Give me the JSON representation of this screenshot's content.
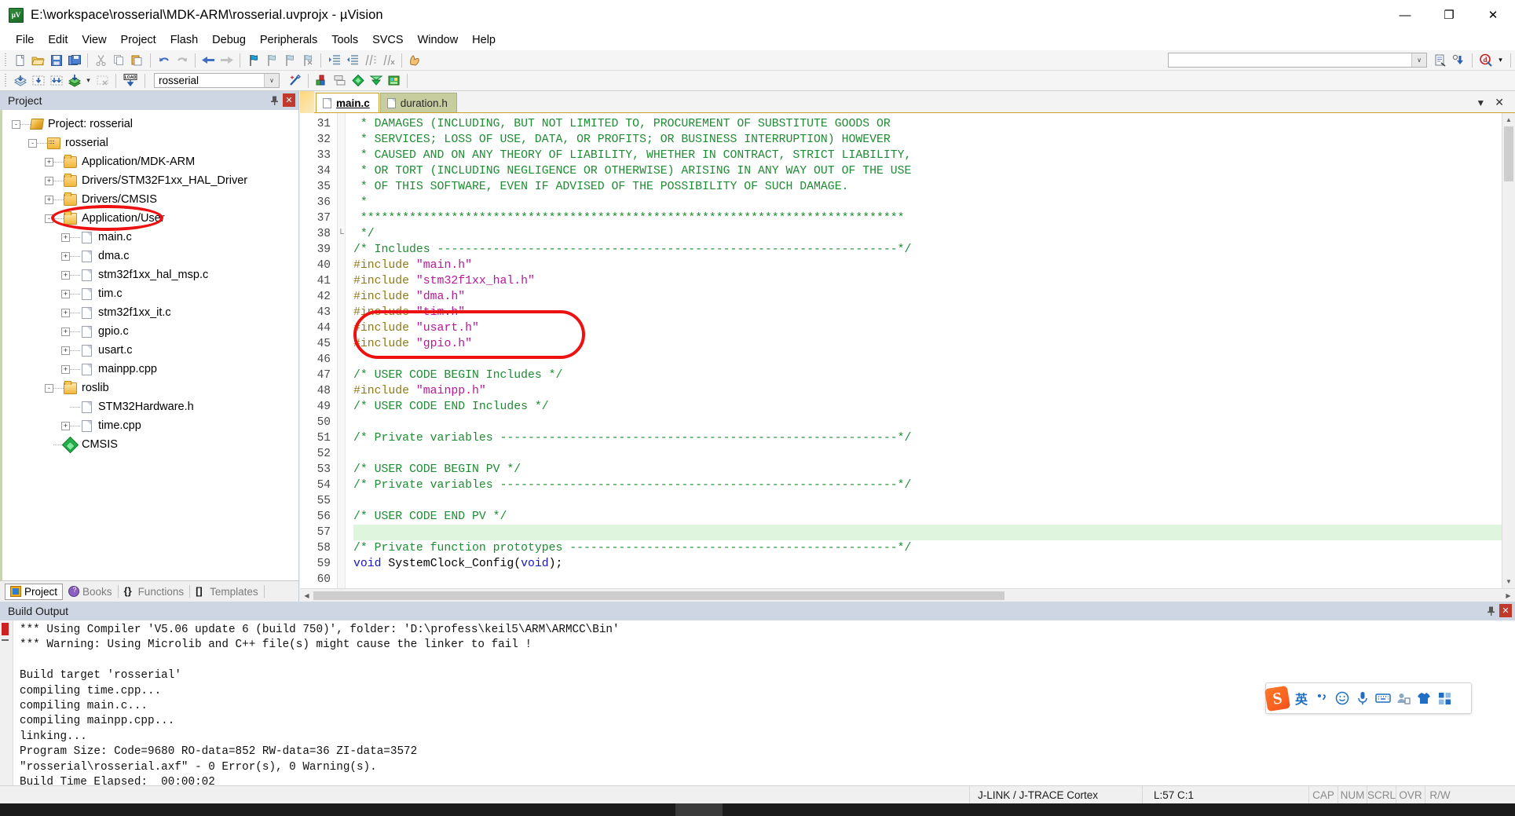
{
  "window": {
    "title": "E:\\workspace\\rosserial\\MDK-ARM\\rosserial.uvprojx - µVision",
    "app_icon": "uvision-icon",
    "minimize": "—",
    "maximize": "❐",
    "close": "✕"
  },
  "menu": {
    "items": [
      {
        "label": "File"
      },
      {
        "label": "Edit"
      },
      {
        "label": "View"
      },
      {
        "label": "Project"
      },
      {
        "label": "Flash"
      },
      {
        "label": "Debug"
      },
      {
        "label": "Peripherals"
      },
      {
        "label": "Tools"
      },
      {
        "label": "SVCS"
      },
      {
        "label": "Window"
      },
      {
        "label": "Help"
      }
    ]
  },
  "toolbar_file": {
    "buttons": [
      "new-file-icon",
      "open-file-icon",
      "save-icon",
      "save-all-icon",
      "cut-icon",
      "copy-icon",
      "paste-icon",
      "undo-icon",
      "redo-icon",
      "navigate-back-icon",
      "navigate-forward-icon",
      "bookmark-toggle-icon",
      "bookmark-prev-icon",
      "bookmark-next-icon",
      "bookmark-clear-icon",
      "indent-icon",
      "outdent-icon",
      "comment-icon",
      "uncomment-icon",
      "insert-occurrence-icon"
    ],
    "find_value": "",
    "find_placeholder": "",
    "find_in_files_icon": "find-in-files-icon",
    "incremental_find_icon": "incremental-find-icon",
    "debug_icon": "start-debug-session-icon",
    "debug_dropdown": "▾"
  },
  "toolbar_build": {
    "buttons": [
      "translate-icon",
      "build-icon",
      "rebuild-icon",
      "batch-build-icon",
      "batch-build-dropdown",
      "stop-build-icon",
      "download-icon"
    ],
    "target_label": "rosserial",
    "target_dropdown": "∨",
    "buttons_right": [
      "target-options-wizard-icon",
      "target-options-icon",
      "manage-project-items-icon",
      "pack-installer-icon",
      "configure-rte-icon",
      "manage-run-time-env-icon"
    ]
  },
  "project_panel": {
    "title": "Project",
    "pin_icon": "pin-icon",
    "close_icon": "close-icon",
    "tree": [
      {
        "label": "Project: rosserial",
        "indent": 0,
        "expander": "-",
        "icon": "project-icon"
      },
      {
        "label": "rosserial",
        "indent": 1,
        "expander": "-",
        "icon": "target-icon"
      },
      {
        "label": "Application/MDK-ARM",
        "indent": 2,
        "expander": "+",
        "icon": "folder-closed-icon"
      },
      {
        "label": "Drivers/STM32F1xx_HAL_Driver",
        "indent": 2,
        "expander": "+",
        "icon": "folder-closed-icon"
      },
      {
        "label": "Drivers/CMSIS",
        "indent": 2,
        "expander": "+",
        "icon": "folder-closed-icon"
      },
      {
        "label": "Application/User",
        "indent": 2,
        "expander": "-",
        "icon": "folder-open-icon"
      },
      {
        "label": "main.c",
        "indent": 3,
        "expander": "+",
        "icon": "file-icon"
      },
      {
        "label": "dma.c",
        "indent": 3,
        "expander": "+",
        "icon": "file-icon"
      },
      {
        "label": "stm32f1xx_hal_msp.c",
        "indent": 3,
        "expander": "+",
        "icon": "file-icon"
      },
      {
        "label": "tim.c",
        "indent": 3,
        "expander": "+",
        "icon": "file-icon"
      },
      {
        "label": "stm32f1xx_it.c",
        "indent": 3,
        "expander": "+",
        "icon": "file-icon"
      },
      {
        "label": "gpio.c",
        "indent": 3,
        "expander": "+",
        "icon": "file-icon"
      },
      {
        "label": "usart.c",
        "indent": 3,
        "expander": "+",
        "icon": "file-icon"
      },
      {
        "label": "mainpp.cpp",
        "indent": 3,
        "expander": "+",
        "icon": "file-icon"
      },
      {
        "label": "roslib",
        "indent": 2,
        "expander": "-",
        "icon": "folder-open-icon"
      },
      {
        "label": "STM32Hardware.h",
        "indent": 3,
        "expander": "",
        "icon": "file-icon"
      },
      {
        "label": "time.cpp",
        "indent": 3,
        "expander": "+",
        "icon": "file-icon"
      },
      {
        "label": "CMSIS",
        "indent": 2,
        "expander": "",
        "icon": "cmsis-icon"
      }
    ],
    "tabs": [
      {
        "label": "Project",
        "icon": "project-tab-icon",
        "active": true
      },
      {
        "label": "Books",
        "icon": "books-tab-icon",
        "active": false
      },
      {
        "label": "Functions",
        "icon": "functions-tab-icon",
        "active": false
      },
      {
        "label": "Templates",
        "icon": "templates-tab-icon",
        "active": false
      }
    ]
  },
  "editor": {
    "tabs": [
      {
        "label": "main.c",
        "active": true
      },
      {
        "label": "duration.h",
        "active": false
      }
    ],
    "tab_dropdown_icon": "tab-list-dropdown-icon",
    "tab_close_icon": "close-document-icon",
    "first_line_number": 31,
    "highlight_line": 57,
    "lines": [
      {
        "n": 31,
        "tokens": [
          {
            "t": "cmt",
            "v": " * DAMAGES (INCLUDING, BUT NOT LIMITED TO, PROCUREMENT OF SUBSTITUTE GOODS OR"
          }
        ]
      },
      {
        "n": 32,
        "tokens": [
          {
            "t": "cmt",
            "v": " * SERVICES; LOSS OF USE, DATA, OR PROFITS; OR BUSINESS INTERRUPTION) HOWEVER"
          }
        ]
      },
      {
        "n": 33,
        "tokens": [
          {
            "t": "cmt",
            "v": " * CAUSED AND ON ANY THEORY OF LIABILITY, WHETHER IN CONTRACT, STRICT LIABILITY,"
          }
        ]
      },
      {
        "n": 34,
        "tokens": [
          {
            "t": "cmt",
            "v": " * OR TORT (INCLUDING NEGLIGENCE OR OTHERWISE) ARISING IN ANY WAY OUT OF THE USE"
          }
        ]
      },
      {
        "n": 35,
        "tokens": [
          {
            "t": "cmt",
            "v": " * OF THIS SOFTWARE, EVEN IF ADVISED OF THE POSSIBILITY OF SUCH DAMAGE."
          }
        ]
      },
      {
        "n": 36,
        "tokens": [
          {
            "t": "cmt",
            "v": " *"
          }
        ]
      },
      {
        "n": 37,
        "tokens": [
          {
            "t": "cmt",
            "v": " ******************************************************************************"
          }
        ]
      },
      {
        "n": 38,
        "tokens": [
          {
            "t": "cmt",
            "v": " */"
          }
        ]
      },
      {
        "n": 39,
        "tokens": [
          {
            "t": "cmt",
            "v": "/* Includes ------------------------------------------------------------------*/"
          }
        ]
      },
      {
        "n": 40,
        "tokens": [
          {
            "t": "pre",
            "v": "#include "
          },
          {
            "t": "str",
            "v": "\"main.h\""
          }
        ]
      },
      {
        "n": 41,
        "tokens": [
          {
            "t": "pre",
            "v": "#include "
          },
          {
            "t": "str",
            "v": "\"stm32f1xx_hal.h\""
          }
        ]
      },
      {
        "n": 42,
        "tokens": [
          {
            "t": "pre",
            "v": "#include "
          },
          {
            "t": "str",
            "v": "\"dma.h\""
          }
        ]
      },
      {
        "n": 43,
        "tokens": [
          {
            "t": "pre",
            "v": "#include "
          },
          {
            "t": "str",
            "v": "\"tim.h\""
          }
        ]
      },
      {
        "n": 44,
        "tokens": [
          {
            "t": "pre",
            "v": "#include "
          },
          {
            "t": "str",
            "v": "\"usart.h\""
          }
        ]
      },
      {
        "n": 45,
        "tokens": [
          {
            "t": "pre",
            "v": "#include "
          },
          {
            "t": "str",
            "v": "\"gpio.h\""
          }
        ]
      },
      {
        "n": 46,
        "tokens": []
      },
      {
        "n": 47,
        "tokens": [
          {
            "t": "cmt",
            "v": "/* USER CODE BEGIN Includes */"
          }
        ]
      },
      {
        "n": 48,
        "tokens": [
          {
            "t": "pre",
            "v": "#include "
          },
          {
            "t": "str",
            "v": "\"mainpp.h\""
          }
        ]
      },
      {
        "n": 49,
        "tokens": [
          {
            "t": "cmt",
            "v": "/* USER CODE END Includes */"
          }
        ]
      },
      {
        "n": 50,
        "tokens": []
      },
      {
        "n": 51,
        "tokens": [
          {
            "t": "cmt",
            "v": "/* Private variables ---------------------------------------------------------*/"
          }
        ]
      },
      {
        "n": 52,
        "tokens": []
      },
      {
        "n": 53,
        "tokens": [
          {
            "t": "cmt",
            "v": "/* USER CODE BEGIN PV */"
          }
        ]
      },
      {
        "n": 54,
        "tokens": [
          {
            "t": "cmt",
            "v": "/* Private variables ---------------------------------------------------------*/"
          }
        ]
      },
      {
        "n": 55,
        "tokens": []
      },
      {
        "n": 56,
        "tokens": [
          {
            "t": "cmt",
            "v": "/* USER CODE END PV */"
          }
        ]
      },
      {
        "n": 57,
        "tokens": []
      },
      {
        "n": 58,
        "tokens": [
          {
            "t": "cmt",
            "v": "/* Private function prototypes -----------------------------------------------*/"
          }
        ]
      },
      {
        "n": 59,
        "tokens": [
          {
            "t": "kw",
            "v": "void"
          },
          {
            "t": "txt",
            "v": " SystemClock_Config("
          },
          {
            "t": "kw",
            "v": "void"
          },
          {
            "t": "txt",
            "v": ");"
          }
        ]
      },
      {
        "n": 60,
        "tokens": []
      }
    ]
  },
  "annotations": {
    "ellipse_main_c": "red-ellipse-highlight-main-c",
    "ellipse_includes": "red-ellipse-highlight-user-includes"
  },
  "build_output": {
    "title": "Build Output",
    "pin_icon": "pin-icon",
    "close_icon": "close-icon",
    "lines": [
      "*** Using Compiler 'V5.06 update 6 (build 750)', folder: 'D:\\profess\\keil5\\ARM\\ARMCC\\Bin'",
      "*** Warning: Using Microlib and C++ file(s) might cause the linker to fail !",
      "",
      "Build target 'rosserial'",
      "compiling time.cpp...",
      "compiling main.c...",
      "compiling mainpp.cpp...",
      "linking...",
      "Program Size: Code=9680 RO-data=852 RW-data=36 ZI-data=3572",
      "\"rosserial\\rosserial.axf\" - 0 Error(s), 0 Warning(s).",
      "Build Time Elapsed:  00:00:02"
    ]
  },
  "ime": {
    "logo": "sogou-logo-icon",
    "logo_letter": "S",
    "items": [
      {
        "glyph": "英",
        "name": "english-mode-icon"
      },
      {
        "glyph": "•,",
        "name": "punctuation-mode-icon"
      },
      {
        "glyph": "☺",
        "name": "emoji-icon"
      },
      {
        "glyph": "⬤",
        "name": "voice-input-icon"
      },
      {
        "glyph": "⌨",
        "name": "soft-keyboard-icon"
      },
      {
        "glyph": "☻",
        "name": "user-account-icon"
      },
      {
        "glyph": "▲",
        "name": "skin-icon"
      },
      {
        "glyph": "▦",
        "name": "toolbox-icon"
      }
    ]
  },
  "statusbar": {
    "message": "",
    "debug_adapter": "J-LINK / J-TRACE Cortex",
    "cursor_position": "L:57 C:1",
    "keys": [
      "CAP",
      "NUM",
      "SCRL",
      "OVR",
      "R/W"
    ]
  }
}
